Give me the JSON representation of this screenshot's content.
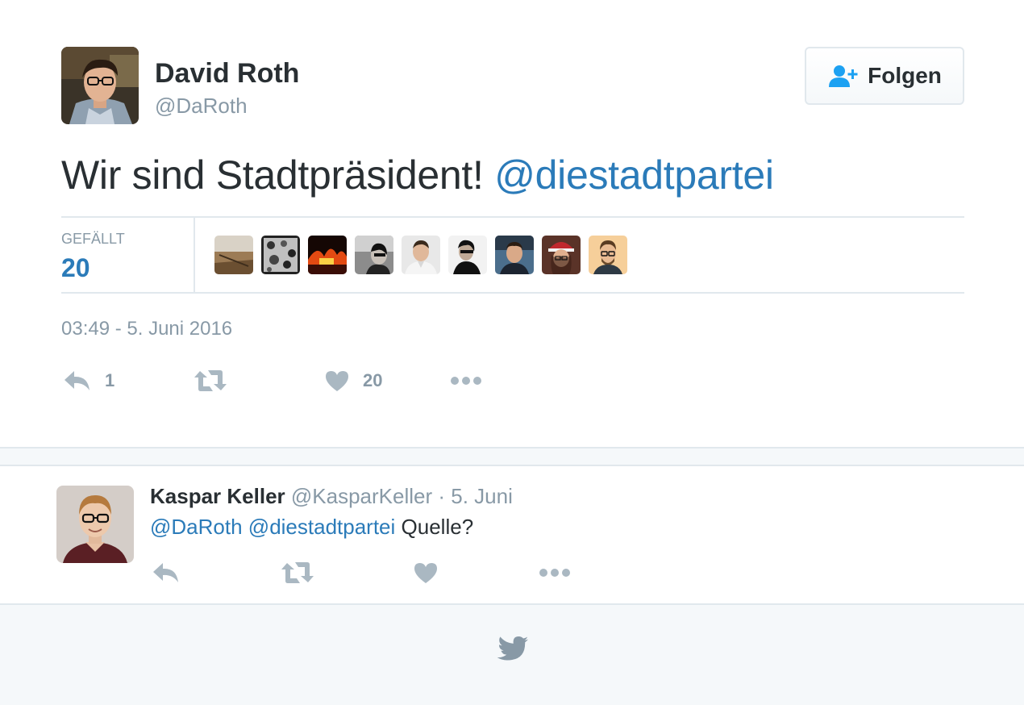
{
  "tweet": {
    "author": {
      "name": "David Roth",
      "handle": "@DaRoth"
    },
    "follow_label": "Folgen",
    "text_plain": "Wir sind Stadtpräsident! ",
    "text_mention": "@diestadtpartei",
    "likes_label": "GEFÄLLT",
    "likes_count": "20",
    "liker_count": 9,
    "timestamp": "03:49 - 5. Juni 2016",
    "actions": {
      "reply_icon": "reply-icon",
      "reply_count": "1",
      "retweet_icon": "retweet-icon",
      "like_icon": "heart-icon",
      "like_count": "20",
      "more_icon": "more-icon"
    }
  },
  "reply": {
    "author": {
      "name": "Kaspar Keller",
      "handle": "@KasparKeller"
    },
    "separator": " · ",
    "time": "5. Juni",
    "mention_1": "@DaRoth",
    "mention_2": "@diestadtpartei",
    "text": "Quelle?"
  },
  "footer": {
    "icon": "twitter-bird-icon"
  },
  "colors": {
    "accent": "#2b7bb9",
    "text": "#292f33",
    "muted": "#8899a6",
    "border": "#e1e8ed",
    "band": "#f5f8fa",
    "icon": "#aab8c2"
  }
}
